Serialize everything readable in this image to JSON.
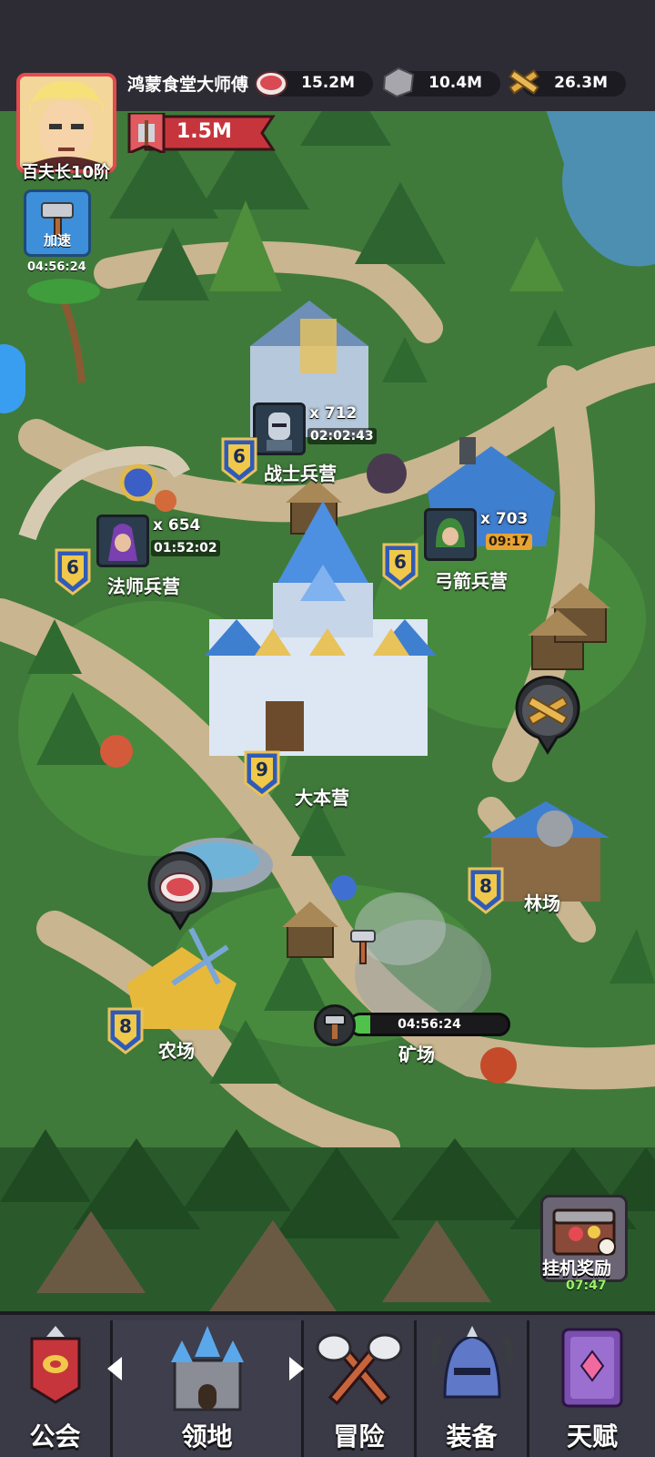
{
  "player": {
    "name": "鸿蒙食堂大师傅",
    "rank": "百夫长10阶",
    "power": "1.5M"
  },
  "resources": [
    {
      "icon": "meat-icon",
      "value": "15.2M"
    },
    {
      "icon": "stone-icon",
      "value": "10.4M"
    },
    {
      "icon": "wood-icon",
      "value": "26.3M"
    }
  ],
  "speedup": {
    "label": "加速",
    "timer": "04:56:24"
  },
  "buildings": {
    "warrior": {
      "name": "战士兵营",
      "level": "6",
      "count": "x 712",
      "timer": "02:02:43"
    },
    "mage": {
      "name": "法师兵营",
      "level": "6",
      "count": "x 654",
      "timer": "01:52:02"
    },
    "archer": {
      "name": "弓箭兵营",
      "level": "6",
      "count": "x 703",
      "timer": "09:17"
    },
    "hq": {
      "name": "大本营",
      "level": "9"
    },
    "lumber": {
      "name": "林场",
      "level": "8"
    },
    "farm": {
      "name": "农场",
      "level": "8"
    },
    "mine": {
      "name": "矿场",
      "timer": "04:56:24",
      "progress": 0.12
    }
  },
  "idle_reward": {
    "label": "挂机奖励",
    "timer": "07:47"
  },
  "nav": {
    "tabs": [
      {
        "label": "公会",
        "icon": "guild-banner-icon"
      },
      {
        "label": "领地",
        "icon": "castle-icon"
      },
      {
        "label": "冒险",
        "icon": "crossed-axes-icon"
      },
      {
        "label": "装备",
        "icon": "helmet-icon"
      },
      {
        "label": "天赋",
        "icon": "spellbook-icon"
      }
    ],
    "active": "领地"
  },
  "colors": {
    "grass": "#3f7a3a",
    "path": "#c9b58f",
    "badge": "#2f5bb8",
    "avatar_border": "#e54a4f",
    "power_banner": "#c7353c",
    "progress": "#4fc24b"
  }
}
